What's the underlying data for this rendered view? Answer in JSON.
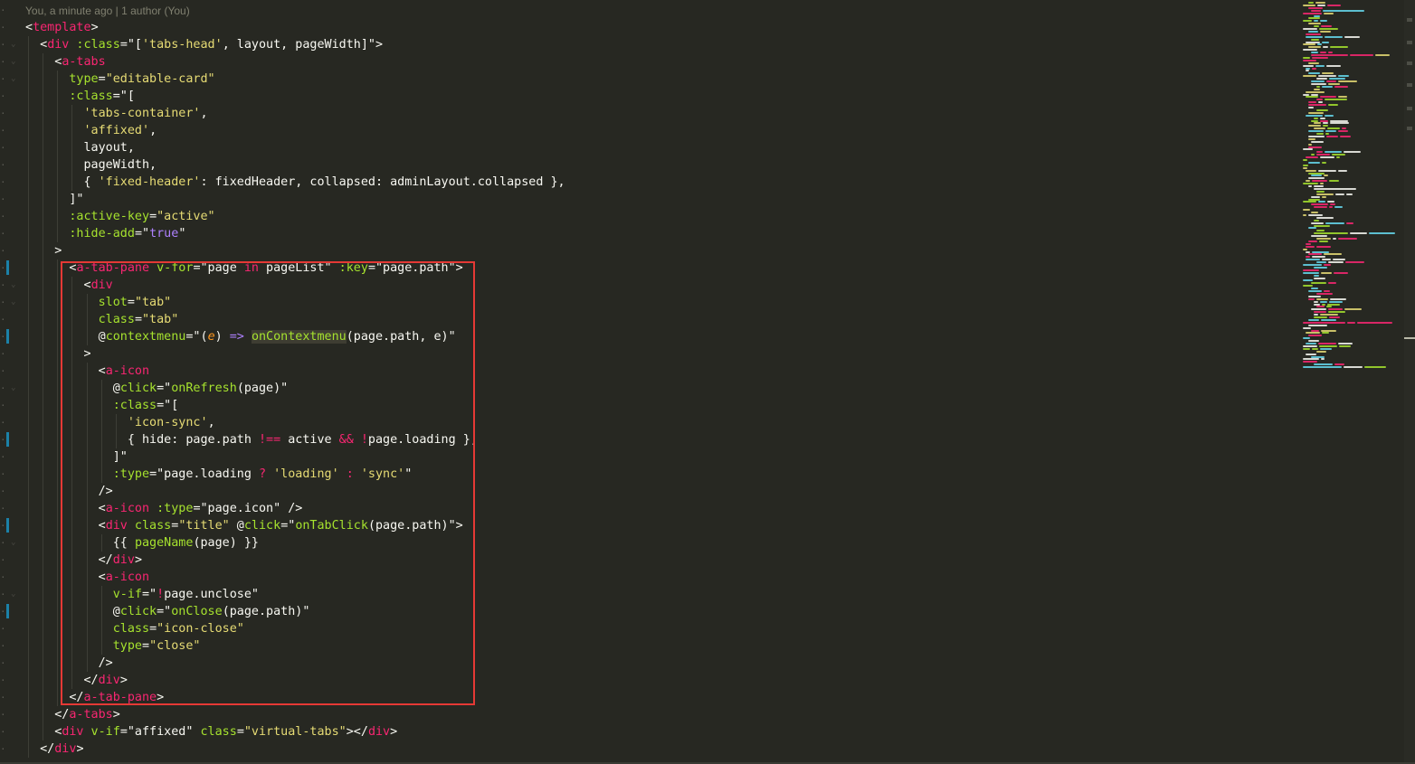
{
  "editor": {
    "blame_annotation": "You, a minute ago | 1 author (You)",
    "colors": {
      "background": "#272822",
      "tag": "#f92672",
      "attribute": "#a6e22e",
      "string": "#e6db74",
      "keyword": "#ae81ff",
      "highlight_box": "#e53935",
      "modified_marker": "#1b81a8"
    }
  },
  "code_lines": [
    [
      {
        "t": "<",
        "c": "p"
      },
      {
        "t": "template",
        "c": "t"
      },
      {
        "t": ">",
        "c": "p"
      }
    ],
    [
      {
        "t": "  <",
        "c": "p"
      },
      {
        "t": "div",
        "c": "t"
      },
      {
        "t": " :class",
        "c": "a"
      },
      {
        "t": "=\"[",
        "c": "p"
      },
      {
        "t": "'tabs-head'",
        "c": "s"
      },
      {
        "t": ", layout, pageWidth]\">",
        "c": "p"
      }
    ],
    [
      {
        "t": "    <",
        "c": "p"
      },
      {
        "t": "a-tabs",
        "c": "t"
      }
    ],
    [
      {
        "t": "      type",
        "c": "a"
      },
      {
        "t": "=",
        "c": "p"
      },
      {
        "t": "\"editable-card\"",
        "c": "s"
      }
    ],
    [
      {
        "t": "      :class",
        "c": "a"
      },
      {
        "t": "=\"[",
        "c": "p"
      }
    ],
    [
      {
        "t": "        ",
        "c": "p"
      },
      {
        "t": "'tabs-container'",
        "c": "s"
      },
      {
        "t": ",",
        "c": "p"
      }
    ],
    [
      {
        "t": "        ",
        "c": "p"
      },
      {
        "t": "'affixed'",
        "c": "s"
      },
      {
        "t": ",",
        "c": "p"
      }
    ],
    [
      {
        "t": "        layout,",
        "c": "p"
      }
    ],
    [
      {
        "t": "        pageWidth,",
        "c": "p"
      }
    ],
    [
      {
        "t": "        { ",
        "c": "p"
      },
      {
        "t": "'fixed-header'",
        "c": "s"
      },
      {
        "t": ": fixedHeader, collapsed: adminLayout.collapsed },",
        "c": "p"
      }
    ],
    [
      {
        "t": "      ]\"",
        "c": "p"
      }
    ],
    [
      {
        "t": "      :active-key",
        "c": "a"
      },
      {
        "t": "=",
        "c": "p"
      },
      {
        "t": "\"active\"",
        "c": "s"
      }
    ],
    [
      {
        "t": "      :hide-add",
        "c": "a"
      },
      {
        "t": "=\"",
        "c": "p"
      },
      {
        "t": "true",
        "c": "b"
      },
      {
        "t": "\"",
        "c": "p"
      }
    ],
    [
      {
        "t": "    >",
        "c": "p"
      }
    ],
    [
      {
        "t": "      <",
        "c": "p"
      },
      {
        "t": "a-tab-pane",
        "c": "t"
      },
      {
        "t": " v-for",
        "c": "a"
      },
      {
        "t": "=\"page ",
        "c": "p"
      },
      {
        "t": "in",
        "c": "k"
      },
      {
        "t": " pageList\"",
        "c": "p"
      },
      {
        "t": " :key",
        "c": "a"
      },
      {
        "t": "=\"page.path\">",
        "c": "p"
      }
    ],
    [
      {
        "t": "        <",
        "c": "p"
      },
      {
        "t": "div",
        "c": "t"
      }
    ],
    [
      {
        "t": "          slot",
        "c": "a"
      },
      {
        "t": "=",
        "c": "p"
      },
      {
        "t": "\"tab\"",
        "c": "s"
      }
    ],
    [
      {
        "t": "          class",
        "c": "a"
      },
      {
        "t": "=",
        "c": "p"
      },
      {
        "t": "\"tab\"",
        "c": "s"
      }
    ],
    [
      {
        "t": "          @",
        "c": "p"
      },
      {
        "t": "contextmenu",
        "c": "a"
      },
      {
        "t": "=\"(",
        "c": "p"
      },
      {
        "t": "e",
        "c": "i"
      },
      {
        "t": ") ",
        "c": "p"
      },
      {
        "t": "=>",
        "c": "b"
      },
      {
        "t": " ",
        "c": "p"
      },
      {
        "t": "onContextmenu",
        "c": "fh"
      },
      {
        "t": "(page.path, e)\"",
        "c": "p"
      }
    ],
    [
      {
        "t": "        >",
        "c": "p"
      }
    ],
    [
      {
        "t": "          <",
        "c": "p"
      },
      {
        "t": "a-icon",
        "c": "t"
      }
    ],
    [
      {
        "t": "            @",
        "c": "p"
      },
      {
        "t": "click",
        "c": "a"
      },
      {
        "t": "=\"",
        "c": "p"
      },
      {
        "t": "onRefresh",
        "c": "f"
      },
      {
        "t": "(page)\"",
        "c": "p"
      }
    ],
    [
      {
        "t": "            :class",
        "c": "a"
      },
      {
        "t": "=\"[",
        "c": "p"
      }
    ],
    [
      {
        "t": "              ",
        "c": "p"
      },
      {
        "t": "'icon-sync'",
        "c": "s"
      },
      {
        "t": ",",
        "c": "p"
      }
    ],
    [
      {
        "t": "              { hide: page.path ",
        "c": "p"
      },
      {
        "t": "!==",
        "c": "o"
      },
      {
        "t": " active ",
        "c": "p"
      },
      {
        "t": "&&",
        "c": "o"
      },
      {
        "t": " ",
        "c": "p"
      },
      {
        "t": "!",
        "c": "o"
      },
      {
        "t": "page.loading },",
        "c": "p"
      }
    ],
    [
      {
        "t": "            ]\"",
        "c": "p"
      }
    ],
    [
      {
        "t": "            :type",
        "c": "a"
      },
      {
        "t": "=\"page.loading ",
        "c": "p"
      },
      {
        "t": "?",
        "c": "o"
      },
      {
        "t": " ",
        "c": "p"
      },
      {
        "t": "'loading'",
        "c": "s"
      },
      {
        "t": " ",
        "c": "p"
      },
      {
        "t": ":",
        "c": "o"
      },
      {
        "t": " ",
        "c": "p"
      },
      {
        "t": "'sync'",
        "c": "s"
      },
      {
        "t": "\"",
        "c": "p"
      }
    ],
    [
      {
        "t": "          />",
        "c": "p"
      }
    ],
    [
      {
        "t": "          <",
        "c": "p"
      },
      {
        "t": "a-icon",
        "c": "t"
      },
      {
        "t": " :type",
        "c": "a"
      },
      {
        "t": "=\"page.icon\" />",
        "c": "p"
      }
    ],
    [
      {
        "t": "          <",
        "c": "p"
      },
      {
        "t": "div",
        "c": "t"
      },
      {
        "t": " class",
        "c": "a"
      },
      {
        "t": "=",
        "c": "p"
      },
      {
        "t": "\"title\"",
        "c": "s"
      },
      {
        "t": " @",
        "c": "p"
      },
      {
        "t": "click",
        "c": "a"
      },
      {
        "t": "=\"",
        "c": "p"
      },
      {
        "t": "onTabClick",
        "c": "f"
      },
      {
        "t": "(page.path)\">",
        "c": "p"
      }
    ],
    [
      {
        "t": "            {{ ",
        "c": "p"
      },
      {
        "t": "pageName",
        "c": "f"
      },
      {
        "t": "(page) }}",
        "c": "p"
      }
    ],
    [
      {
        "t": "          </",
        "c": "p"
      },
      {
        "t": "div",
        "c": "t"
      },
      {
        "t": ">",
        "c": "p"
      }
    ],
    [
      {
        "t": "          <",
        "c": "p"
      },
      {
        "t": "a-icon",
        "c": "t"
      }
    ],
    [
      {
        "t": "            v-if",
        "c": "a"
      },
      {
        "t": "=\"",
        "c": "p"
      },
      {
        "t": "!",
        "c": "o"
      },
      {
        "t": "page.unclose\"",
        "c": "p"
      }
    ],
    [
      {
        "t": "            @",
        "c": "p"
      },
      {
        "t": "click",
        "c": "a"
      },
      {
        "t": "=\"",
        "c": "p"
      },
      {
        "t": "onClose",
        "c": "f"
      },
      {
        "t": "(page.path)\"",
        "c": "p"
      }
    ],
    [
      {
        "t": "            class",
        "c": "a"
      },
      {
        "t": "=",
        "c": "p"
      },
      {
        "t": "\"icon-close\"",
        "c": "s"
      }
    ],
    [
      {
        "t": "            type",
        "c": "a"
      },
      {
        "t": "=",
        "c": "p"
      },
      {
        "t": "\"close\"",
        "c": "s"
      }
    ],
    [
      {
        "t": "          />",
        "c": "p"
      }
    ],
    [
      {
        "t": "        </",
        "c": "p"
      },
      {
        "t": "div",
        "c": "t"
      },
      {
        "t": ">",
        "c": "p"
      }
    ],
    [
      {
        "t": "      </",
        "c": "p"
      },
      {
        "t": "a-tab-pane",
        "c": "t"
      },
      {
        "t": ">",
        "c": "p"
      }
    ],
    [
      {
        "t": "    </",
        "c": "p"
      },
      {
        "t": "a-tabs",
        "c": "t"
      },
      {
        "t": ">",
        "c": "p"
      }
    ],
    [
      {
        "t": "    <",
        "c": "p"
      },
      {
        "t": "div",
        "c": "t"
      },
      {
        "t": " v-if",
        "c": "a"
      },
      {
        "t": "=\"affixed\"",
        "c": "p"
      },
      {
        "t": " class",
        "c": "a"
      },
      {
        "t": "=",
        "c": "p"
      },
      {
        "t": "\"virtual-tabs\"",
        "c": "s"
      },
      {
        "t": "></",
        "c": "p"
      },
      {
        "t": "div",
        "c": "t"
      },
      {
        "t": ">",
        "c": "p"
      }
    ],
    [
      {
        "t": "  </",
        "c": "p"
      },
      {
        "t": "div",
        "c": "t"
      },
      {
        "t": ">",
        "c": "p"
      }
    ]
  ],
  "modified_lines": [
    15,
    19,
    25,
    30,
    35
  ],
  "fold_lines": [
    1,
    2,
    3,
    15,
    16,
    21,
    30,
    33
  ]
}
